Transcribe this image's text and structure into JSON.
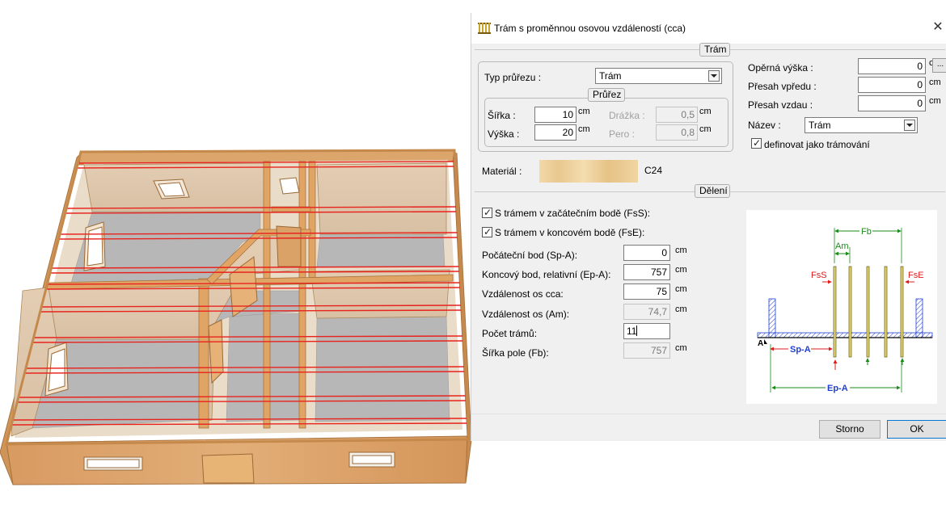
{
  "dialog": {
    "title": "Trám s proměnnou osovou vzdáleností (cca)",
    "close_glyph": "✕",
    "title_icon": "beam-icon",
    "beam_section": {
      "label": "Trám",
      "section_type_label": "Typ průřezu :",
      "section_type_value": "Trám",
      "profile": {
        "label": "Průřez",
        "width_label": "Šířka :",
        "width_value": "10",
        "width_unit": "cm",
        "height_label": "Výška :",
        "height_value": "20",
        "height_unit": "cm",
        "groove_label": "Drážka :",
        "groove_value": "0,5",
        "groove_unit": "cm",
        "tongue_label": "Pero :",
        "tongue_value": "0,8",
        "tongue_unit": "cm"
      },
      "support_height_label": "Opěrná výška :",
      "support_height_value": "0",
      "support_height_unit": "cm",
      "more_button_label": "...",
      "front_overhang_label": "Přesah vpředu :",
      "front_overhang_value": "0",
      "front_overhang_unit": "cm",
      "back_overhang_label": "Přesah vzdau :",
      "back_overhang_value": "0",
      "back_overhang_unit": "cm",
      "name_label": "Název :",
      "name_value": "Trám",
      "define_as_joists_label": "definovat jako trámování",
      "define_as_joists_checked": true
    },
    "material": {
      "label": "Materiál :",
      "value": "C24"
    },
    "division": {
      "label": "Dělení",
      "start_beam_label": "S trámem v začátečním bodě (FsS):",
      "start_beam_checked": true,
      "end_beam_label": "S trámem v koncovém bodě (FsE):",
      "end_beam_checked": true,
      "start_point_label": "Počáteční bod  (Sp-A):",
      "start_point_value": "0",
      "start_point_unit": "cm",
      "end_point_label": "Koncový bod, relativní  (Ep-A):",
      "end_point_value": "757",
      "end_point_unit": "cm",
      "axis_distance_approx_label": "Vzdálenost os cca:",
      "axis_distance_approx_value": "75",
      "axis_distance_approx_unit": "cm",
      "axis_distance_label": "Vzdálenost os (Am):",
      "axis_distance_value": "74,7",
      "axis_distance_unit": "cm",
      "beam_count_label": "Počet trámů:",
      "beam_count_value": "11",
      "field_width_label": "Šířka pole (Fb):",
      "field_width_value": "757",
      "field_width_unit": "cm"
    },
    "diagram": {
      "fb_label": "Fb",
      "am_label": "Am",
      "fss_label": "FsS",
      "fse_label": "FsE",
      "a_label": "A",
      "spa_label": "Sp-A",
      "epa_label": "Ep-A"
    },
    "buttons": {
      "cancel_label": "Storno",
      "ok_label": "OK"
    }
  },
  "colors": {
    "dialog_background": "#f0f0f0",
    "wood": "#d9a066",
    "beam_lines": "#e8231e",
    "floor": "#b5b5b5",
    "diagram_green": "#1a8a1a",
    "diagram_blue": "#1f3fd0",
    "diagram_red": "#e01b1b"
  }
}
